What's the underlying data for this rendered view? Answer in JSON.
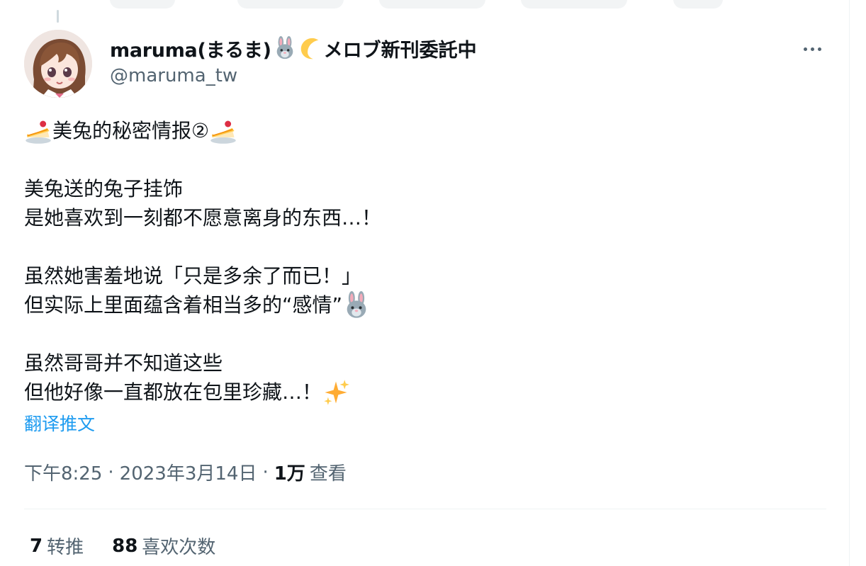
{
  "tweet": {
    "author": {
      "display_name": "maruma(まるま)",
      "display_name_suffix": "メロブ新刊委託中",
      "name_emoji_1": "rabbit-face-icon",
      "name_emoji_2": "crescent-moon-icon",
      "handle": "@maruma_tw",
      "avatar": "avatar-anime-girl"
    },
    "more_label": "更多",
    "body_lines": [
      {
        "pre_emoji": "shortcake-icon",
        "text": "美兔的秘密情报②",
        "post_emoji": "shortcake-icon"
      },
      {
        "text": ""
      },
      {
        "text": "美兔送的兔子挂饰"
      },
      {
        "text": "是她喜欢到一刻都不愿意离身的东西…！"
      },
      {
        "text": ""
      },
      {
        "text": "虽然她害羞地说「只是多余了而已！」"
      },
      {
        "text": "但实际上里面蕴含着相当多的“感情”",
        "post_emoji": "rabbit-face-icon"
      },
      {
        "text": ""
      },
      {
        "text": "虽然哥哥并不知道这些"
      },
      {
        "text": "但他好像一直都放在包里珍藏…！",
        "post_emoji": "sparkles-icon"
      }
    ],
    "translate_label": "翻译推文",
    "time": "下午8:25",
    "separator": "·",
    "date": "2023年3月14日",
    "views_count": "1万",
    "views_label": "查看",
    "retweets_count": "7",
    "retweets_label": "转推",
    "likes_count": "88",
    "likes_label": "喜欢次数"
  },
  "colors": {
    "text": "#0f1419",
    "secondary": "#536471",
    "link": "#1d9bf0",
    "divider": "#eff3f4"
  }
}
